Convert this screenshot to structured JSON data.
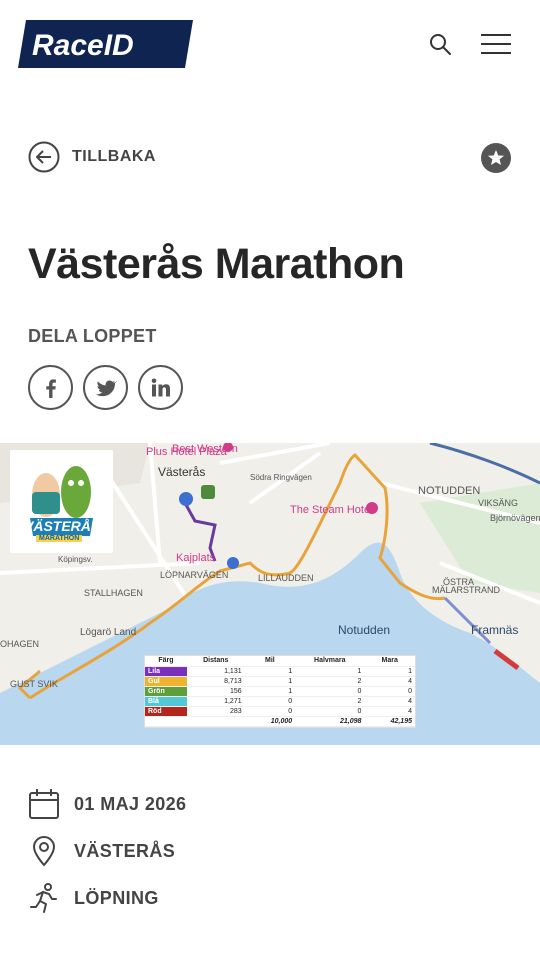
{
  "header": {
    "logo_text": "RaceID",
    "search_icon": "search-icon",
    "menu_icon": "hamburger-menu-icon"
  },
  "nav": {
    "back_label": "TILLBAKA",
    "favorite_icon": "star-icon"
  },
  "event": {
    "title": "Västerås Marathon",
    "share_label": "DELA LOPPET",
    "social": [
      "facebook",
      "twitter",
      "linkedin"
    ],
    "date": "01 MAJ 2026",
    "location": "VÄSTERÅS",
    "type": "LÖPNING"
  },
  "map": {
    "labels": {
      "hotel1": "Best Western",
      "hotel2": "Plus Hotel Plaza",
      "city": "Västerås",
      "steam": "The Steam Hotel",
      "notudden_top": "NOTUDDEN",
      "notudden": "Notudden",
      "viksang": "VIKSÄNG",
      "ostra": "ÖSTRA",
      "malarstrand": "MÄLARSTRAND",
      "framnas": "Framnäs",
      "kajplats": "Kajplats",
      "lillaudden": "LILLAUDDEN",
      "lopnarvagen": "LÖPNARVÄGEN",
      "stallhagen": "STALLHAGEN",
      "loppland": "Lögarö Land",
      "ohagen": "OHAGEN",
      "gustsvik": "GUST  SVIK",
      "koping": "Köpingsv.",
      "sodra": "Södra Ringvägen",
      "bjornbo": "Björnövägen"
    },
    "logo_text_1": "VÄSTERÅS",
    "logo_text_2": "MARATHON",
    "colors": {
      "route_yellow": "#e8a33a",
      "route_purple": "#6a3aa0",
      "route_red": "#d63a3a",
      "water": "#b9d7ee",
      "land": "#f1efe9",
      "park": "#d7ead0"
    },
    "table": {
      "headers": [
        "Färg",
        "Distans",
        "Mil",
        "Halvmara",
        "Mara"
      ],
      "rows": [
        {
          "name": "Lila",
          "color": "#7b2fbf",
          "values": [
            "1,131",
            "1",
            "1",
            "1"
          ]
        },
        {
          "name": "Gul",
          "color": "#f0b32f",
          "values": [
            "8,713",
            "1",
            "2",
            "4"
          ]
        },
        {
          "name": "Grön",
          "color": "#5f9e3a",
          "values": [
            "156",
            "1",
            "0",
            "0"
          ]
        },
        {
          "name": "Blå",
          "color": "#52c7d6",
          "values": [
            "1,271",
            "0",
            "2",
            "4"
          ]
        },
        {
          "name": "Röd",
          "color": "#b3261e",
          "values": [
            "283",
            "0",
            "0",
            "4"
          ]
        }
      ],
      "totals": [
        "",
        "",
        "10,000",
        "21,098",
        "42,195"
      ]
    }
  }
}
